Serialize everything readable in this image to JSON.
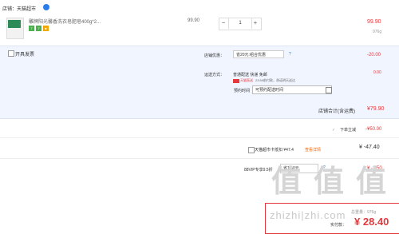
{
  "shop": {
    "label": "店铺：天猫超市"
  },
  "item": {
    "title": "雕牌阳光馨香洗衣皂肥皂400g*2...",
    "tags": [
      "7",
      "7",
      "■"
    ],
    "unit_price": "99.90",
    "quantity": "1",
    "minus": "−",
    "plus": "+",
    "subtotal": "99.90",
    "weight": "976g"
  },
  "invoice": {
    "label": "开具发票"
  },
  "shop_discount": {
    "label": "店铺优惠：",
    "selected": "省20元:组合优惠",
    "amount": "-20.00",
    "help": "?"
  },
  "shipping": {
    "label": "运送方式：",
    "standard": "普通配送 快递 免邮",
    "tmall_tag": "天猫直送",
    "cutoff": "23:59前付款，承诺明天送达",
    "amount": "0.00",
    "appointment_label": "预约时间",
    "appointment_value": "可预约配送时间"
  },
  "store_total": {
    "label": "店铺合计(含运费)",
    "amount": "¥79.90"
  },
  "promo": {
    "label": "下单立减",
    "amount": "-¥50.00",
    "check": "✓"
  },
  "card": {
    "label": "天猫超市卡抵扣 ¥47.4",
    "link": "查看详情",
    "amount": "¥ -47.40"
  },
  "vip": {
    "label": "88VIP专享9.5折",
    "selected": "省1.50元",
    "amount": "¥ -1.50",
    "help": "?"
  },
  "payment": {
    "weight": "总重量：976g",
    "label": "实付款：",
    "amount": "¥ 28.40"
  },
  "watermark": {
    "glyphs": [
      "值",
      "值",
      "值"
    ],
    "text": "zhizhi|zhi.com"
  },
  "colors": {
    "accent": "#e4393c",
    "link": "#2b7de9",
    "panel": "#f0f5ff"
  }
}
